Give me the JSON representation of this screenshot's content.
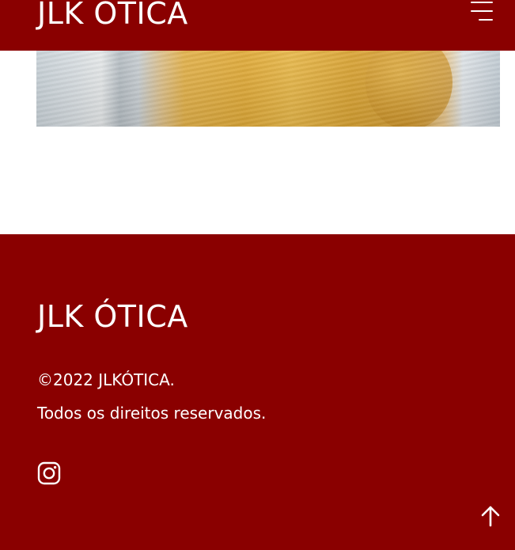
{
  "header": {
    "brand": "JLK ÓTICA",
    "menu_icon": "hamburger-menu-icon"
  },
  "hero": {
    "image": "person-in-yellow-knit-sweater-photo"
  },
  "footer": {
    "brand": "JLK ÓTICA",
    "copyright": "©2022 JLKÓTICA.",
    "rights": "Todos os direitos reservados.",
    "social_icon": "instagram-icon",
    "back_to_top_icon": "arrow-up-icon"
  },
  "colors": {
    "brand": "#8a0000",
    "text_on_brand": "#ffffff",
    "background": "#ffffff"
  }
}
